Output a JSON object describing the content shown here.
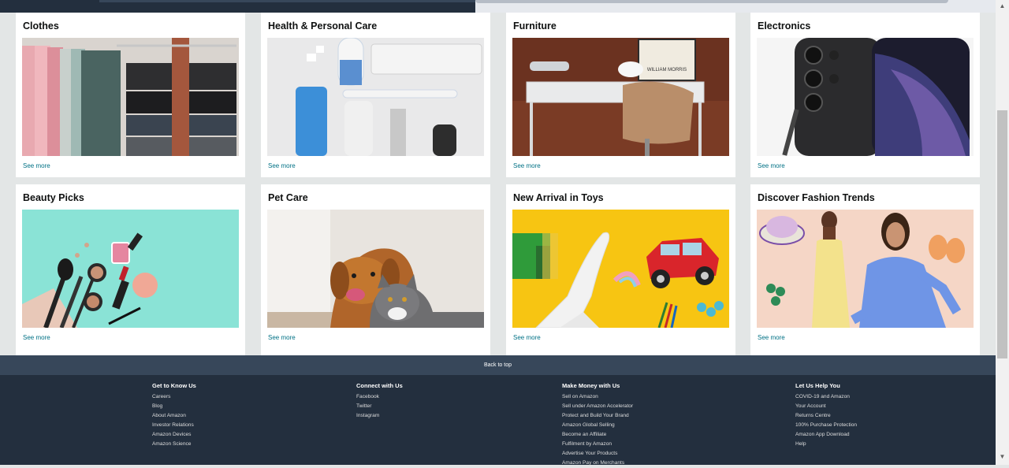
{
  "cards": [
    {
      "title": "Clothes",
      "link": "See more",
      "image": "clothes-hanger-photo"
    },
    {
      "title": "Health & Personal Care",
      "link": "See more",
      "image": "toiletries-photo"
    },
    {
      "title": "Furniture",
      "link": "See more",
      "image": "desk-chair-photo",
      "image_text": "WILLIAM MORRIS"
    },
    {
      "title": "Electronics",
      "link": "See more",
      "image": "smartphone-photo"
    },
    {
      "title": "Beauty Picks",
      "link": "See more",
      "image": "makeup-photo"
    },
    {
      "title": "Pet Care",
      "link": "See more",
      "image": "dog-and-cat-photo"
    },
    {
      "title": "New Arrival in Toys",
      "link": "See more",
      "image": "toys-photo"
    },
    {
      "title": "Discover Fashion Trends",
      "link": "See more",
      "image": "fashion-models-photo"
    }
  ],
  "back_to_top": "Back to top",
  "footer": {
    "columns": [
      {
        "heading": "Get to Know Us",
        "links": [
          "Careers",
          "Blog",
          "About Amazon",
          "Investor Relations",
          "Amazon Devices",
          "Amazon Science"
        ]
      },
      {
        "heading": "Connect with Us",
        "links": [
          "Facebook",
          "Twitter",
          "Instagram"
        ]
      },
      {
        "heading": "Make Money with Us",
        "links": [
          "Sell on Amazon",
          "Sell under Amazon Accelerator",
          "Protect and Build Your Brand",
          "Amazon Global Selling",
          "Become an Affiliate",
          "Fulfilment by Amazon",
          "Advertise Your Products",
          "Amazon Pay on Merchants"
        ]
      },
      {
        "heading": "Let Us Help You",
        "links": [
          "COVID-19 and Amazon",
          "Your Account",
          "Returns Centre",
          "100% Purchase Protection",
          "Amazon App Download",
          "Help"
        ]
      }
    ]
  },
  "scrollbar": {
    "up_icon": "arrow-up-icon",
    "down_icon": "arrow-down-icon"
  },
  "colors": {
    "link": "#007185",
    "footer_bg": "#232f3e",
    "backtop_bg": "#37475a",
    "page_bg": "#e3e6e6"
  }
}
